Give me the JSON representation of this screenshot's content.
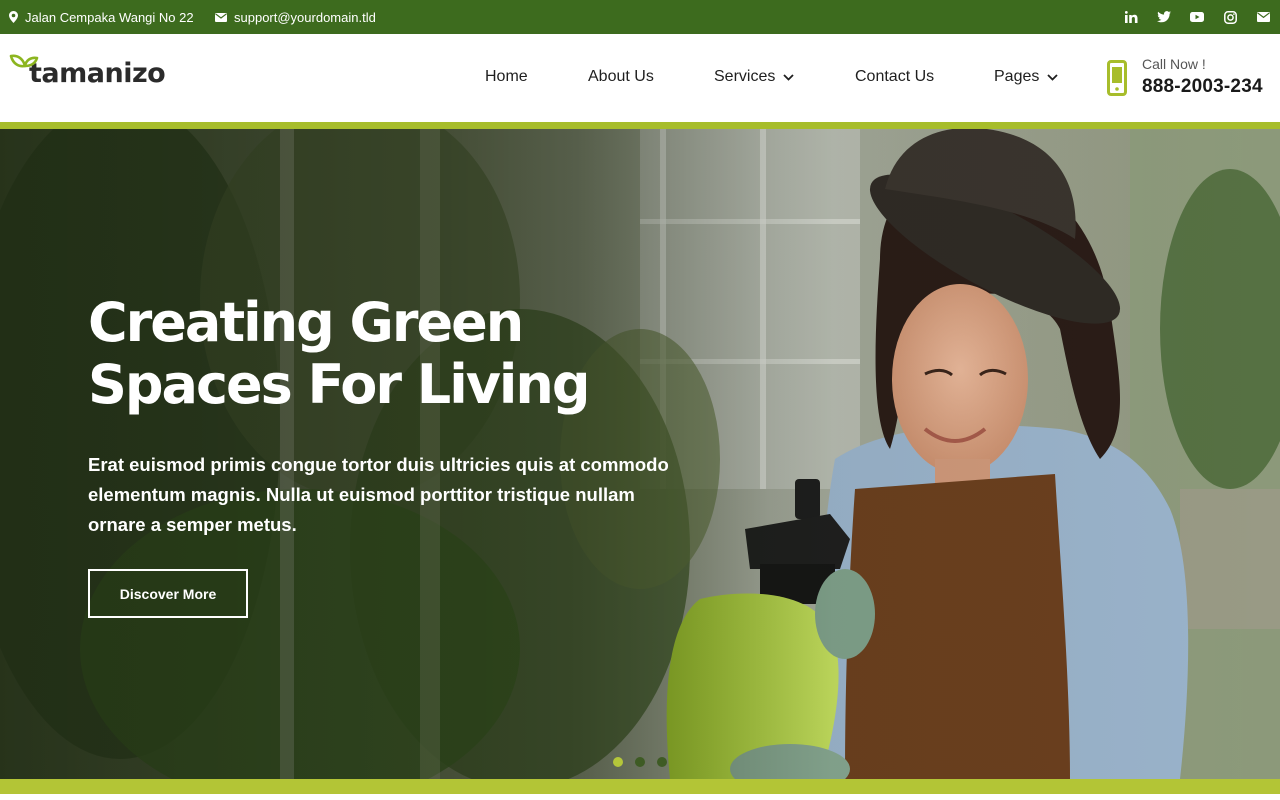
{
  "topbar": {
    "address": "Jalan Cempaka Wangi No 22",
    "email": "support@yourdomain.tld",
    "social": [
      "linkedin-icon",
      "twitter-icon",
      "youtube-icon",
      "instagram-icon",
      "mail-icon"
    ]
  },
  "header": {
    "logo_text": "tamanizo",
    "nav": [
      {
        "label": "Home",
        "has_dropdown": false
      },
      {
        "label": "About Us",
        "has_dropdown": false
      },
      {
        "label": "Services",
        "has_dropdown": true
      },
      {
        "label": "Contact Us",
        "has_dropdown": false
      },
      {
        "label": "Pages",
        "has_dropdown": true
      }
    ],
    "call_label": "Call Now !",
    "call_number": "888-2003-234"
  },
  "hero": {
    "title_line1": "Creating Green",
    "title_line2": "Spaces For Living",
    "text": "Erat euismod primis congue tortor duis ultricies quis at commodo elementum magnis. Nulla ut euismod porttitor tristique nullam ornare a semper metus.",
    "button_label": "Discover More",
    "slides": 3,
    "active_slide": 1
  },
  "colors": {
    "topbar_bg": "#3d6b1e",
    "accent": "#a7bd2b",
    "text_dark": "#1f1f1f"
  }
}
